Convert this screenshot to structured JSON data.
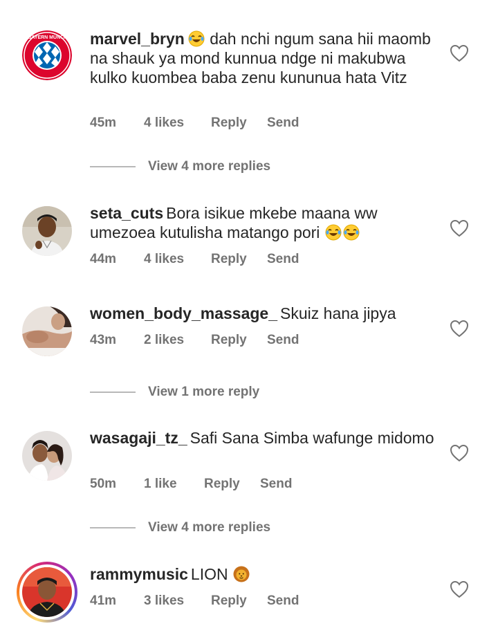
{
  "comments": [
    {
      "username": "marvel_bryn",
      "text": "dah nchi ngum sana hii maomb na shauk ya mond kunnua ndge ni makubwa kulko kuombea baba zenu kununua hata Vitz",
      "time": "45m",
      "likes": "4 likes",
      "reply": "Reply",
      "send": "Send",
      "avatar": "fc-bayern-logo",
      "logo_text": "FC BAYERN MÜNCHEN",
      "view_more": "View 4 more replies"
    },
    {
      "username": "seta_cuts",
      "text": "Bora isikue mkebe maana ww umezoea kutulisha matango pori",
      "time": "44m",
      "likes": "4 likes",
      "reply": "Reply",
      "send": "Send",
      "avatar": "man-photo"
    },
    {
      "username": "women_body_massage_",
      "text": "Skuiz hana jipya",
      "time": "43m",
      "likes": "2 likes",
      "reply": "Reply",
      "send": "Send",
      "avatar": "massage-photo",
      "view_more": "View 1 more reply"
    },
    {
      "username": "wasagaji_tz_",
      "text": "Safi Sana Simba wafunge midomo",
      "time": "50m",
      "likes": "1 like",
      "reply": "Reply",
      "send": "Send",
      "avatar": "couple-photo",
      "view_more": "View 4 more replies"
    },
    {
      "username": "rammymusic",
      "text": "LION",
      "time": "41m",
      "likes": "3 likes",
      "reply": "Reply",
      "send": "Send",
      "avatar": "artist-photo-story-ring"
    }
  ],
  "colors": {
    "text": "#262626",
    "secondary": "#737373",
    "divider": "#b8b8b8",
    "bayern_red": "#dc052d",
    "bayern_blue": "#0066b2"
  },
  "icons": [
    "heart-outline-icon",
    "laughing-tears-emoji",
    "lion-emoji"
  ]
}
